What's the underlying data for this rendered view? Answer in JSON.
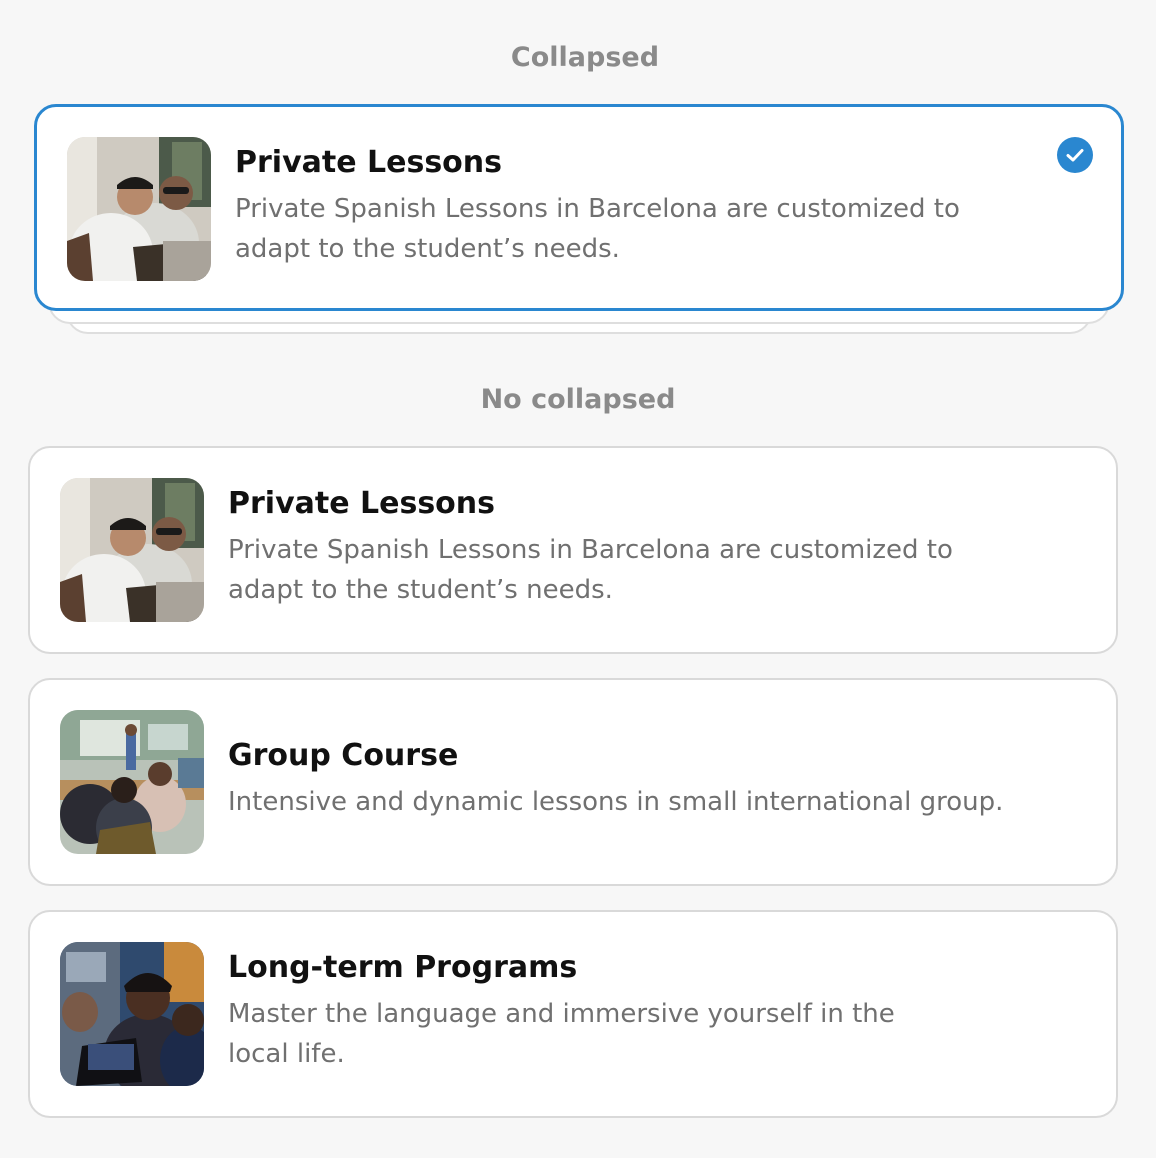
{
  "sections": {
    "collapsed_label": "Collapsed",
    "no_collapsed_label": "No collapsed"
  },
  "collapsed_card": {
    "title": "Private Lessons",
    "description": "Private Spanish Lessons in Barcelona are customized to adapt to the student’s needs.",
    "selected": true,
    "image": "two-students-laptop-photo"
  },
  "cards": [
    {
      "title": "Private Lessons",
      "description": "Private Spanish Lessons in Barcelona are customized to adapt to the student’s needs.",
      "image": "two-students-laptop-photo"
    },
    {
      "title": "Group Course",
      "description": "Intensive and dynamic lessons in small international group.",
      "image": "classroom-group-photo"
    },
    {
      "title": "Long-term Programs",
      "description": "Master the language and immersive yourself in the local life.",
      "image": "students-studying-laptop-photo"
    }
  ],
  "colors": {
    "accent": "#2a87d0",
    "background": "#f7f7f7",
    "card_border": "#d9d9d9",
    "title": "#111111",
    "description": "#707070",
    "section_label": "#8a8a8a"
  }
}
